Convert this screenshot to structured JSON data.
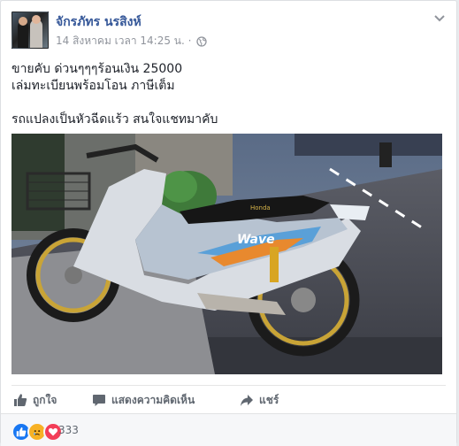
{
  "post": {
    "author": "จักรภัทร นรสิงห์",
    "timestamp": "14 สิงหาคม เวลา 14:25 น.",
    "separator": "·",
    "text_lines": [
      "ขายคับ ด่วนๆๆๆร้อนเงิน 25000",
      "เล่มทะเบียนพร้อมโอน ภาษีเต็ม",
      "รถแปลงเป็นหัวฉีดแร้ว สนใจแชทมาคับ"
    ],
    "photo": {
      "decal_text": "Wave",
      "brand_text": "Honda"
    }
  },
  "actions": {
    "like_label": "ถูกใจ",
    "comment_label": "แสดงความคิดเห็น",
    "share_label": "แชร์"
  },
  "reactions": {
    "count": "333",
    "types": [
      "like-icon",
      "sad-icon",
      "love-icon"
    ]
  },
  "colors": {
    "link": "#365899",
    "meta": "#90949c",
    "like_blue": "#1877f2",
    "love_red": "#f33e58",
    "sad_yellow": "#f7b125"
  }
}
